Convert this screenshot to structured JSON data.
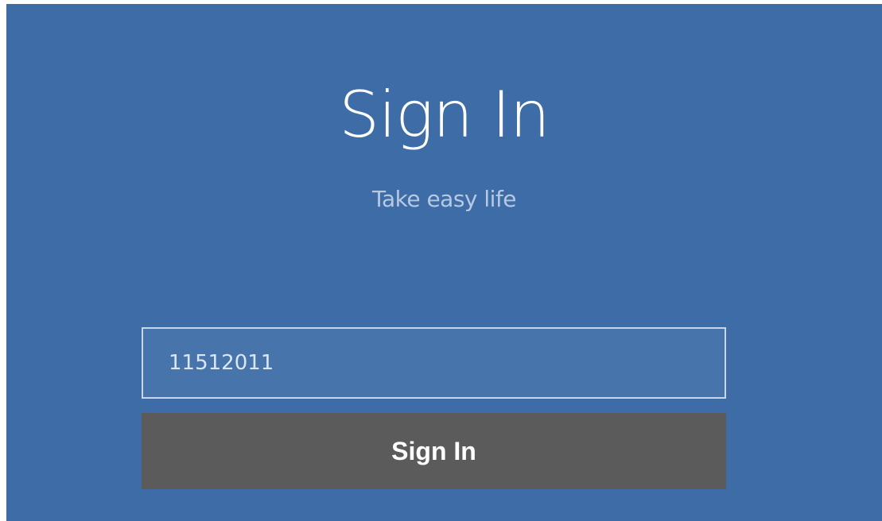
{
  "header": {
    "title": "Sign In",
    "subtitle": "Take easy life"
  },
  "form": {
    "id_field_value": "11512011",
    "submit_label": "Sign In"
  },
  "colors": {
    "panel_bg": "#3d6ca7",
    "button_bg": "#5b5b5b",
    "title_text": "#ffffff",
    "subtitle_text": "#b6c9e3"
  }
}
